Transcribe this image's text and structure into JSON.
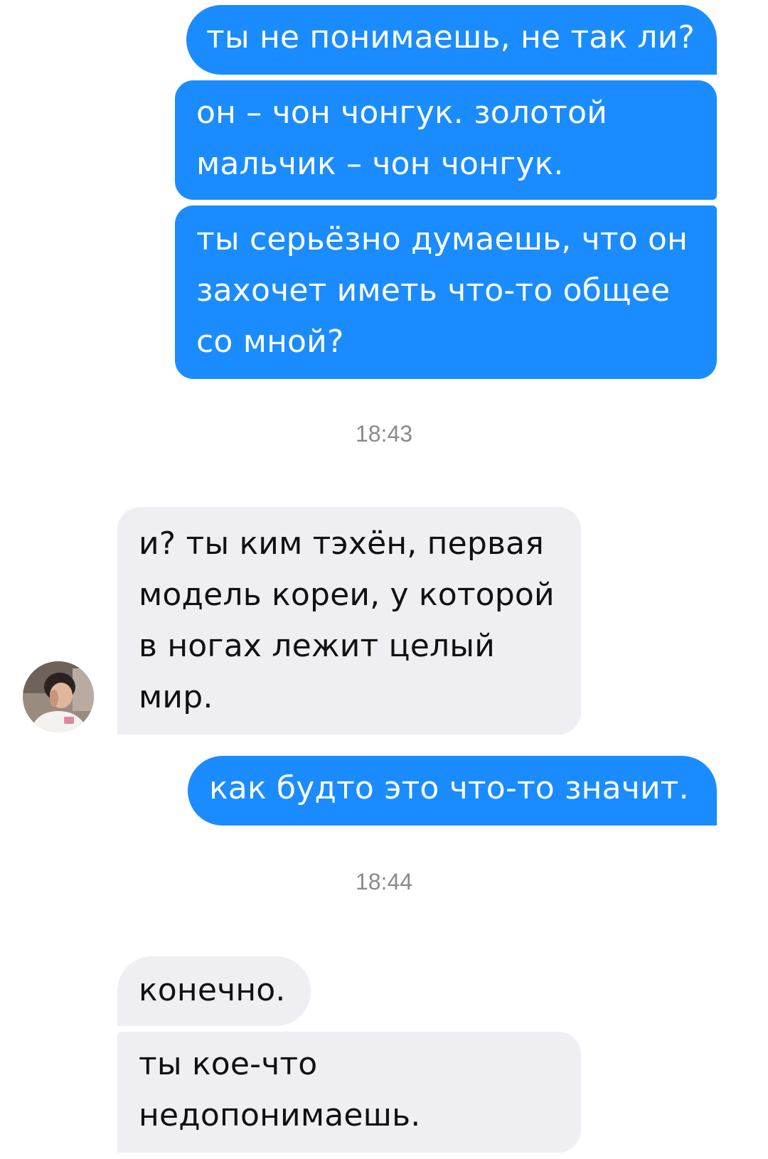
{
  "messages": [
    {
      "direction": "outgoing",
      "text": "ты не понимаешь, не так ли?"
    },
    {
      "direction": "outgoing",
      "text": "он – чон чонгук. золотой\nмальчик – чон чонгук."
    },
    {
      "direction": "outgoing",
      "text": "ты серьёзно думаешь, что он\nзахочет иметь что-то общее\nсо мной?"
    },
    {
      "direction": "incoming",
      "text": "и? ты ким тэхён, первая\nмодель кореи, у которой\nв ногах лежит целый\nмир."
    },
    {
      "direction": "outgoing",
      "text": "как будто это что-то значит."
    },
    {
      "direction": "incoming",
      "text": "конечно."
    },
    {
      "direction": "incoming",
      "text": "ты кое-что\nнедопонимаешь."
    }
  ],
  "timestamps": [
    "18:43",
    "18:44"
  ],
  "contact": {
    "avatar_icon": "contact-avatar-photo"
  },
  "colors": {
    "outgoing_bubble": "#1a8cff",
    "incoming_bubble": "#eeeef3",
    "timestamp_text": "#8a8a8f"
  }
}
